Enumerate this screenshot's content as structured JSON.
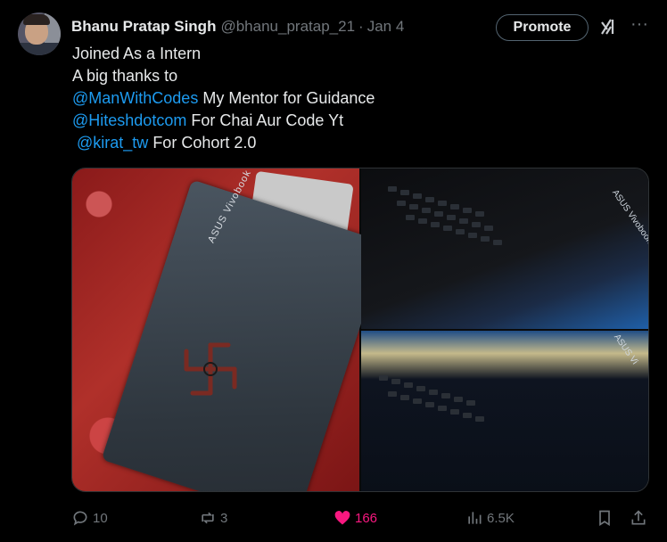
{
  "tweet": {
    "author_name": "Bhanu Pratap Singh",
    "author_handle": "@bhanu_pratap_21",
    "separator": "·",
    "date": "Jan 4",
    "promote_label": "Promote",
    "more_label": "···",
    "lines": [
      {
        "text": "Joined As a Intern"
      },
      {
        "text": "A big thanks to"
      },
      {
        "mention": "@ManWithCodes",
        "text": " My Mentor for Guidance"
      },
      {
        "mention": "@Hiteshdotcom",
        "text": " For Chai Aur Code Yt"
      },
      {
        "lead": " ",
        "mention": "@kirat_tw",
        "text": " For Cohort 2.0"
      }
    ],
    "media": {
      "laptop_brand": "ASUS Vivobook",
      "brand_tr": "ASUS Vivobook",
      "brand_br": "ASUS Vi"
    },
    "stats": {
      "replies": "10",
      "reposts": "3",
      "likes": "166",
      "views": "6.5K"
    }
  },
  "colors": {
    "background": "#000000",
    "text": "#e7e9ea",
    "muted": "#71767b",
    "mention": "#1d9bf0",
    "like": "#f91880"
  }
}
